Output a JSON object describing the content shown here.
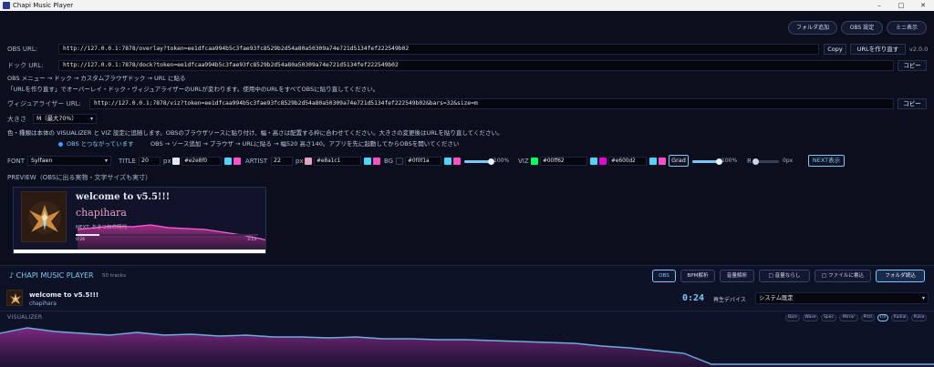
{
  "window": {
    "title": "Chapi Music Player",
    "controls": [
      "–",
      "□",
      "✕"
    ]
  },
  "top_buttons": [
    "フォルダ追加",
    "OBS 設定",
    "ミニ表示"
  ],
  "version": "v2.0.0",
  "obs_url": {
    "label": "OBS URL:",
    "value": "http://127.0.0.1:7878/overlay?token=ee1dfcaa994b5c3fae93fc8529b2d54a80a50309a74e721d5134fef222549b02",
    "copy_label": "Copy",
    "make_label": "URLを作り直す"
  },
  "dock_url": {
    "label": "ドック URL:",
    "value": "http://127.0.0.1:7878/dock?token=ee1dfcaa994b5c3fae93fc8529b2d54a80a50309a74e721d5134fef222549b02",
    "copy_label": "コピー"
  },
  "hint1": "OBS メニュー → ドック → カスタムブラウザドック → URL に貼る",
  "hint2": "「URLを作り直す」でオーバーレイ・ドック・ヴィジュアライザーのURLが変わります。使用中のURLをすべてOBSに貼り直してください。",
  "viz_url": {
    "label": "ヴィジュアライザー URL:",
    "value": "http://127.0.0.1:7878/viz?token=ee1dfcaa994b5c3fae93fc8529b2d54a80a50309a74e721d5134fef222549b02&bars=32&size=m",
    "copy_label": "コピー"
  },
  "size": {
    "label": "大きさ",
    "value": "M（最大70%）"
  },
  "hint3": "色・種類は本体の VISUALIZER と VIZ 設定に追随します。OBSのブラウザソースに貼り付け、幅・高さは配置する枠に合わせてください。大きさの変更後はURLを貼り直してください。",
  "status": {
    "connected": "OBS とつながっています",
    "steps": "OBS → ソース追加 → ブラウザ → URLに貼る → 幅520 高さ140。アプリを先に起動してからOBSを開いてください"
  },
  "settings": {
    "font_label": "FONT",
    "font_value": "Sylfaen",
    "title_label": "TITLE",
    "title_size": "20",
    "px1": "px",
    "title_color": "#e2e8f0",
    "artist_label": "ARTIST",
    "artist_size": "22",
    "px2": "px",
    "artist_color": "#e8a1c1",
    "bg_label": "BG",
    "bg_color": "#0f0f1a",
    "bg_percent": "100%",
    "viz_label": "VIZ",
    "viz_color1": "#00ff62",
    "viz_color2": "#e600d2",
    "grad_label": "Grad",
    "viz_percent": "100%",
    "r_label": "R",
    "r_value": "0px",
    "next_label": "NEXT表示",
    "bg_opacity": 1.0,
    "viz_opacity": 1.0
  },
  "preview": {
    "label": "PREVIEW（OBSに出る実物・文字サイズも実寸）",
    "title": "welcome to v5.5!!!",
    "artist": "chapihara",
    "next": "NEXT: おきつねの時代",
    "time_elapsed": "0:26",
    "time_total": "3:13",
    "progress": 0.13
  },
  "player": {
    "brand": "♪ CHAPI MUSIC PLAYER",
    "track_count": "50 tracks",
    "buttons": [
      "OBS",
      "BPM解析",
      "音量解析",
      "□ 音量ならし",
      "□ ファイルに書込",
      "フォルダ読込"
    ],
    "now_title": "welcome to v5.5!!!",
    "now_artist": "chapihara",
    "time": "0:24",
    "device_label": "再生デバイス",
    "device_value": "システム既定"
  },
  "visualizer": {
    "label": "VISUALIZER",
    "modes": [
      "Bars",
      "Wave",
      "Spec",
      "Mirror",
      "Prtcl",
      "Fill",
      "Radial",
      "Pulse"
    ],
    "active_mode": "Fill"
  },
  "colors": {
    "accent_cyan": "#7ec8f5",
    "viz_blue": "#6aaee0",
    "magenta": "#e23ad8"
  }
}
